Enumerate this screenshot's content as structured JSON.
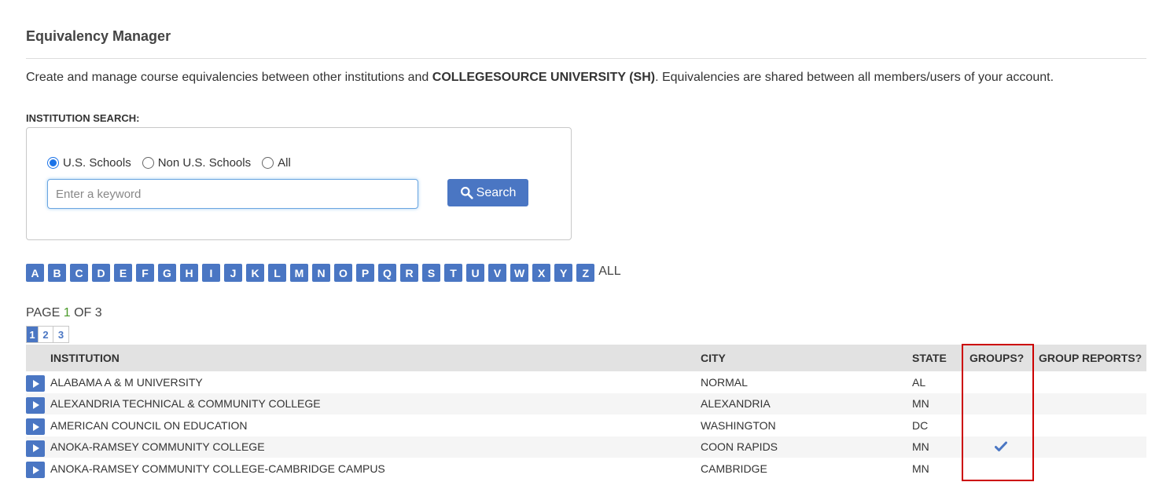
{
  "header": {
    "title": "Equivalency Manager",
    "intro_prefix": "Create and manage course equivalencies between other institutions and ",
    "intro_bold": "COLLEGESOURCE UNIVERSITY (SH)",
    "intro_suffix": ". Equivalencies are shared between all members/users of your account."
  },
  "search": {
    "label": "INSTITUTION SEARCH:",
    "radio_options": [
      "U.S. Schools",
      "Non U.S. Schools",
      "All"
    ],
    "selected_radio": "U.S. Schools",
    "placeholder": "Enter a keyword",
    "value": "",
    "button_label": "Search"
  },
  "alphabet": {
    "letters": [
      "A",
      "B",
      "C",
      "D",
      "E",
      "F",
      "G",
      "H",
      "I",
      "J",
      "K",
      "L",
      "M",
      "N",
      "O",
      "P",
      "Q",
      "R",
      "S",
      "T",
      "U",
      "V",
      "W",
      "X",
      "Y",
      "Z"
    ],
    "all_label": "ALL"
  },
  "pagination": {
    "prefix": "PAGE ",
    "current": "1",
    "suffix": " OF 3",
    "pages": [
      "1",
      "2",
      "3"
    ]
  },
  "table": {
    "columns": [
      "INSTITUTION",
      "CITY",
      "STATE",
      "GROUPS?",
      "GROUP REPORTS?"
    ],
    "rows": [
      {
        "institution": "ALABAMA A & M UNIVERSITY",
        "city": "NORMAL",
        "state": "AL",
        "groups": false
      },
      {
        "institution": "ALEXANDRIA TECHNICAL & COMMUNITY COLLEGE",
        "city": "ALEXANDRIA",
        "state": "MN",
        "groups": false
      },
      {
        "institution": "AMERICAN COUNCIL ON EDUCATION",
        "city": "WASHINGTON",
        "state": "DC",
        "groups": false
      },
      {
        "institution": "ANOKA-RAMSEY COMMUNITY COLLEGE",
        "city": "COON RAPIDS",
        "state": "MN",
        "groups": true
      },
      {
        "institution": "ANOKA-RAMSEY COMMUNITY COLLEGE-CAMBRIDGE CAMPUS",
        "city": "CAMBRIDGE",
        "state": "MN",
        "groups": false
      }
    ]
  },
  "colors": {
    "accent": "#4a76c3",
    "highlight": "#cc0000",
    "current_page": "#4a9a2a"
  },
  "icons": {
    "search_button": "search-icon",
    "row_expand": "play-icon",
    "groups_check": "checkmark-icon"
  }
}
